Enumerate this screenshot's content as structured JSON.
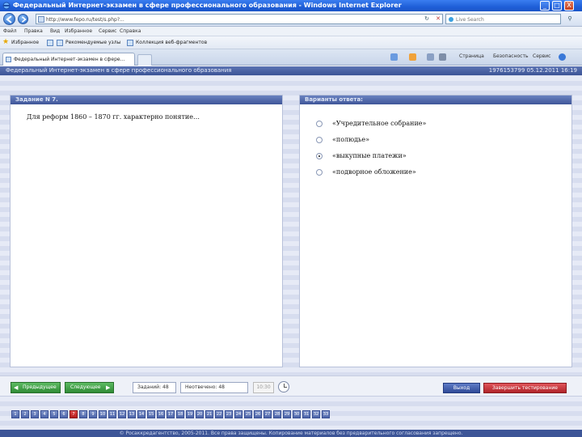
{
  "window": {
    "title": "Федеральный Интернет-экзамен в сфере профессионального образования - Windows Internet Explorer",
    "buttons": {
      "minimize": "_",
      "maximize": "□",
      "close": "X"
    }
  },
  "address": {
    "url": "http://www.fepo.ru/test/s.php?...",
    "search_placeholder": "Live Search"
  },
  "menu": {
    "items": [
      "Файл",
      "Правка",
      "Вид",
      "Избранное",
      "Сервис",
      "Справка"
    ]
  },
  "favorites": {
    "label": "Избранное",
    "items": [
      "Рекомендуемые узлы",
      "Коллекция веб-фрагментов"
    ]
  },
  "tab": {
    "title": "Федеральный Интернет-экзамен в сфере..."
  },
  "commandbar": {
    "items": [
      "Страница",
      "Безопасность",
      "Сервис"
    ]
  },
  "site": {
    "header_title": "Федеральный Интернет-экзамен в сфере профессионального образования",
    "session_info": "1976153799 05.12.2011 16:19"
  },
  "question_panel": {
    "heading": "Задание N 7.",
    "text": "Для реформ 1860 – 1870 гг. характерно понятие…"
  },
  "answers_panel": {
    "heading": "Варианты ответа:",
    "options": [
      {
        "label": "«Учредительное собрание»",
        "selected": false
      },
      {
        "label": "«полюдье»",
        "selected": false
      },
      {
        "label": "«выкупные платежи»",
        "selected": true
      },
      {
        "label": "«подворное обложение»",
        "selected": false
      }
    ]
  },
  "bottom": {
    "prev_label": "Предыдущее",
    "next_label": "Следующее",
    "tasks_label": "Заданий: 48",
    "unanswered_label": "Неотвечено: 48",
    "timer": "10:30",
    "home_label": "Выход",
    "finish_label": "Завершить тестирование"
  },
  "pager": {
    "current": 7,
    "pages": [
      "1",
      "2",
      "3",
      "4",
      "5",
      "6",
      "7",
      "8",
      "9",
      "10",
      "11",
      "12",
      "13",
      "14",
      "15",
      "16",
      "17",
      "18",
      "19",
      "20",
      "21",
      "22",
      "23",
      "24",
      "25",
      "26",
      "27",
      "28",
      "29",
      "30",
      "31",
      "32",
      "33"
    ]
  },
  "footer": {
    "text": "© Росаккредагентство, 2005-2011. Все права защищены. Копирование материалов без предварительного согласования запрещено."
  },
  "colors": {
    "header_blue": "#3b5396",
    "green_button": "#2f8b35",
    "red_button": "#b0242a",
    "current_page": "#b31d1d"
  }
}
